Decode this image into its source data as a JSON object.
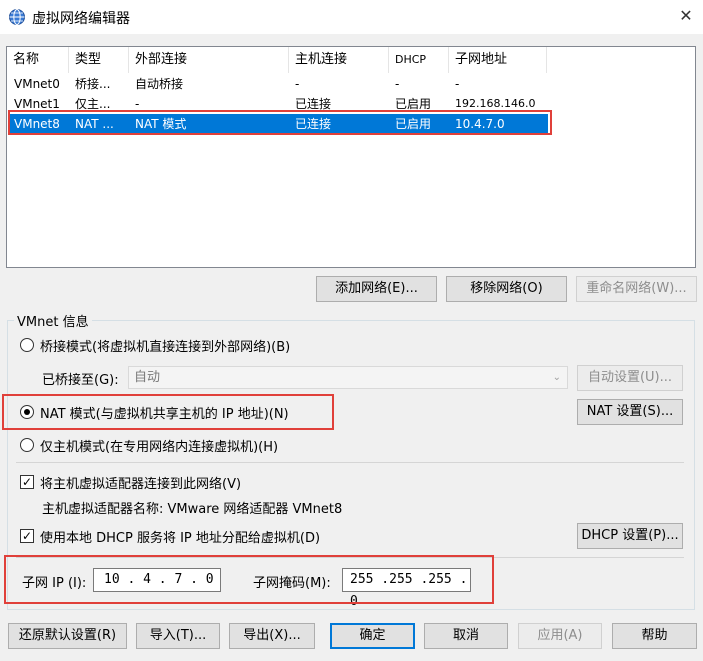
{
  "window": {
    "title": "虚拟网络编辑器",
    "close_glyph": "✕"
  },
  "list": {
    "headers": [
      "名称",
      "类型",
      "外部连接",
      "主机连接",
      "DHCP",
      "子网地址"
    ],
    "rows": [
      {
        "name": "VMnet0",
        "type": "桥接...",
        "external": "自动桥接",
        "host": "-",
        "dhcp": "-",
        "subnet": "-",
        "selected": false
      },
      {
        "name": "VMnet1",
        "type": "仅主...",
        "external": "-",
        "host": "已连接",
        "dhcp": "已启用",
        "subnet": "192.168.146.0",
        "selected": false
      },
      {
        "name": "VMnet8",
        "type": "NAT ...",
        "external": "NAT 模式",
        "host": "已连接",
        "dhcp": "已启用",
        "subnet": "10.4.7.0",
        "selected": true
      }
    ]
  },
  "list_buttons": {
    "add": "添加网络(E)...",
    "remove": "移除网络(O)",
    "rename": "重命名网络(W)..."
  },
  "vmnet_info": {
    "label": "VMnet 信息",
    "bridged_radio": "桥接模式(将虚拟机直接连接到外部网络)(B)",
    "bridged_to_label": "已桥接至(G):",
    "bridged_to_value": "自动",
    "auto_settings": "自动设置(U)...",
    "nat_radio": "NAT 模式(与虚拟机共享主机的 IP 地址)(N)",
    "nat_settings": "NAT 设置(S)...",
    "hostonly_radio": "仅主机模式(在专用网络内连接虚拟机)(H)",
    "selected_mode": "nat",
    "connect_adapter_check": "将主机虚拟适配器连接到此网络(V)",
    "connect_adapter_checked": true,
    "adapter_name": "主机虚拟适配器名称: VMware 网络适配器 VMnet8",
    "dhcp_check": "使用本地 DHCP 服务将 IP 地址分配给虚拟机(D)",
    "dhcp_checked": true,
    "dhcp_settings": "DHCP 设置(P)...",
    "subnet_ip_label": "子网 IP (I):",
    "subnet_ip_value": "10 . 4 . 7 . 0",
    "subnet_mask_label": "子网掩码(M):",
    "subnet_mask_value": "255 .255 .255 . 0"
  },
  "footer_buttons": {
    "restore": "还原默认设置(R)",
    "import": "导入(T)...",
    "export": "导出(X)...",
    "ok": "确定",
    "cancel": "取消",
    "apply": "应用(A)",
    "help": "帮助"
  },
  "colors": {
    "selection": "#0078d7",
    "highlight_box": "#e0403a",
    "window_bg": "#f0f0f0"
  },
  "icons": {
    "app": "network-globe-icon",
    "check": "✓",
    "dropdown": "⌄"
  }
}
